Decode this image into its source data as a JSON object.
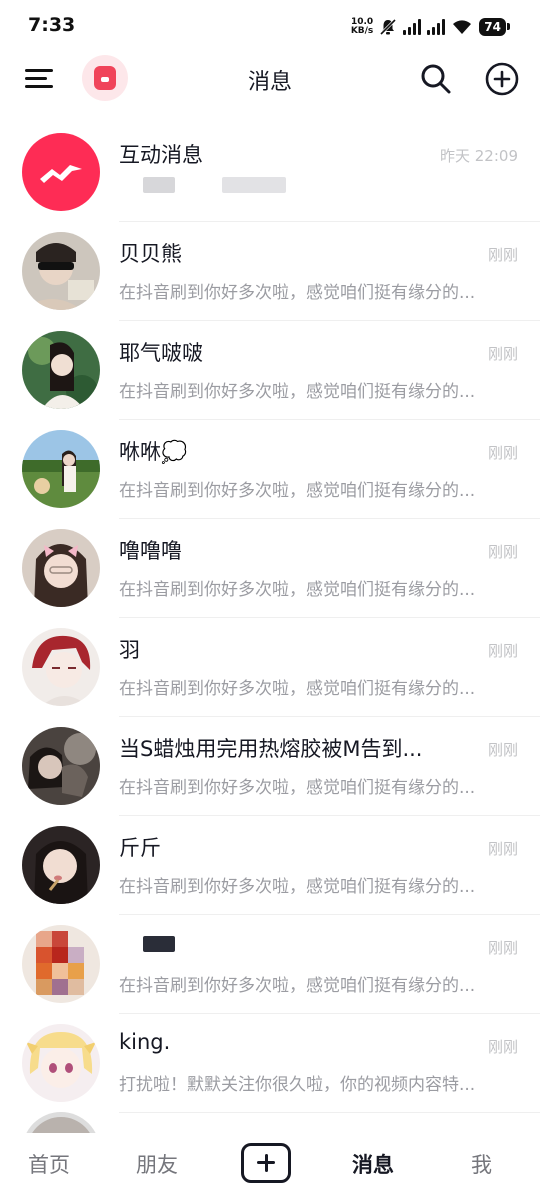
{
  "status_bar": {
    "time": "7:33",
    "net_speed_value": "10.0",
    "net_speed_unit": "KB/s",
    "battery": "74"
  },
  "header": {
    "title": "消息",
    "icons": [
      "menu-icon",
      "app-badge-icon",
      "search-icon",
      "plus-circle-icon"
    ]
  },
  "conversations": [
    {
      "name": "互动消息",
      "time": "昨天 22:09",
      "preview": "",
      "avatar_color": "#fe2c55"
    },
    {
      "name": "贝贝熊",
      "time": "刚刚",
      "preview": "在抖音刷到你好多次啦，感觉咱们挺有缘分的..."
    },
    {
      "name": "耶气啵啵",
      "time": "刚刚",
      "preview": "在抖音刷到你好多次啦，感觉咱们挺有缘分的..."
    },
    {
      "name": "咻咻💭",
      "time": "刚刚",
      "preview": "在抖音刷到你好多次啦，感觉咱们挺有缘分的..."
    },
    {
      "name": "噜噜噜",
      "time": "刚刚",
      "preview": "在抖音刷到你好多次啦，感觉咱们挺有缘分的..."
    },
    {
      "name": "羽",
      "time": "刚刚",
      "preview": "在抖音刷到你好多次啦，感觉咱们挺有缘分的..."
    },
    {
      "name": "当S蜡烛用完用热熔胶被M告到...",
      "time": "刚刚",
      "preview": "在抖音刷到你好多次啦，感觉咱们挺有缘分的..."
    },
    {
      "name": "斤斤",
      "time": "刚刚",
      "preview": "在抖音刷到你好多次啦，感觉咱们挺有缘分的..."
    },
    {
      "name": "",
      "time": "刚刚",
      "preview": "在抖音刷到你好多次啦，感觉咱们挺有缘分的..."
    },
    {
      "name": "king.",
      "time": "刚刚",
      "preview": "打扰啦！默默关注你很久啦，你的视频内容特..."
    }
  ],
  "bottom_nav": {
    "home": "首页",
    "friends": "朋友",
    "messages": "消息",
    "me": "我",
    "active": "消息"
  },
  "colors": {
    "accent": "#fe2c55",
    "text_primary": "#161823",
    "text_secondary": "#9b9ca2",
    "time_text": "#c2c3c6"
  }
}
